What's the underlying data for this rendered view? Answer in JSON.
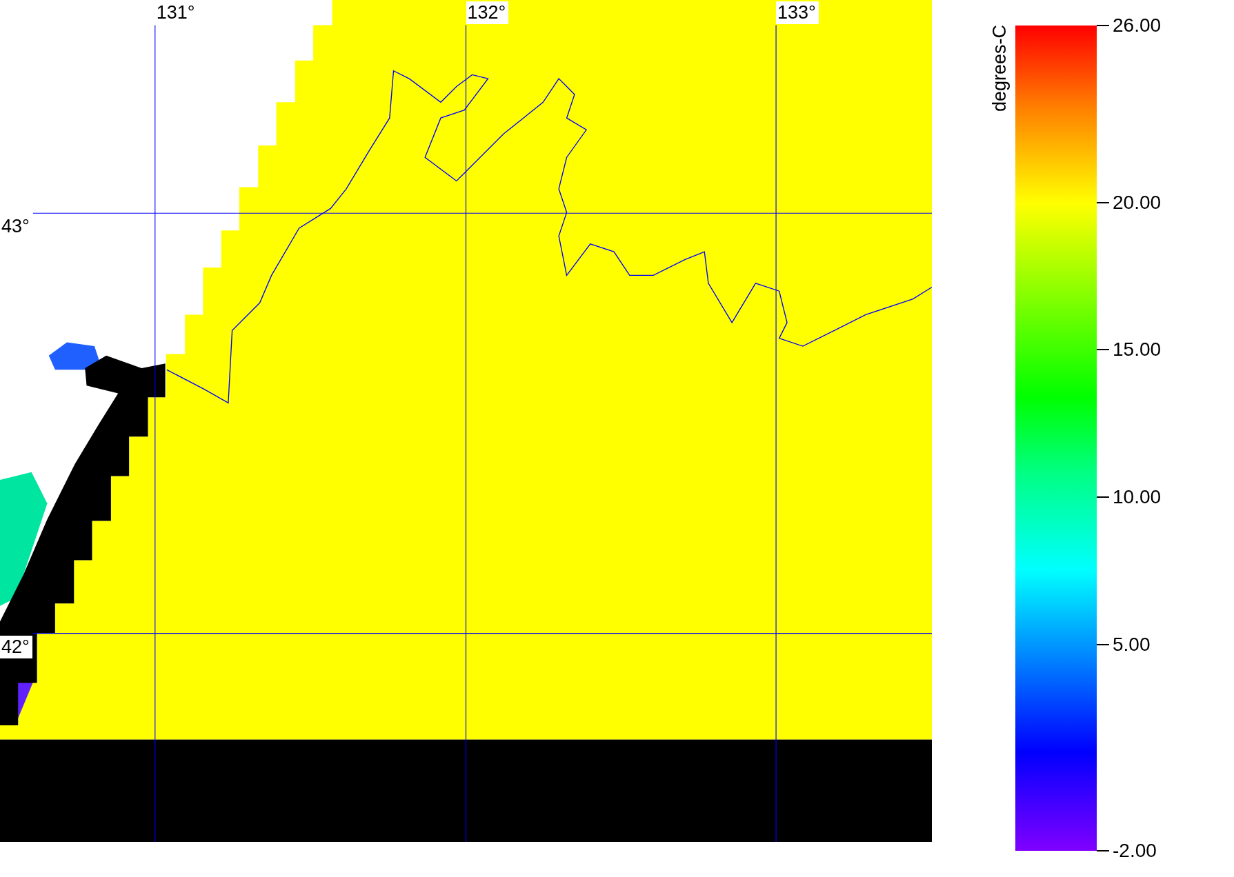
{
  "map": {
    "longitude_labels": [
      "131°",
      "132°",
      "133°"
    ],
    "latitude_labels": [
      "43°",
      "42°"
    ]
  },
  "colorbar": {
    "unit": "degrees-C",
    "tick_labels": [
      "26.00",
      "20.00",
      "15.00",
      "10.00",
      "5.00",
      "-2.00"
    ]
  }
}
